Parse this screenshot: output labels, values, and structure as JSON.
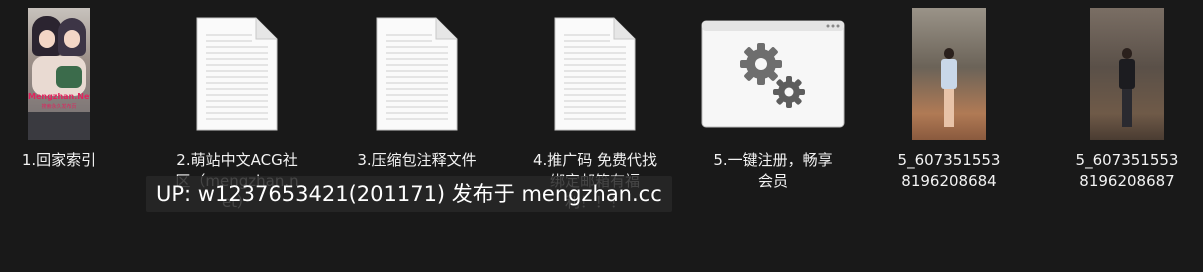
{
  "files": [
    {
      "label": "1.回家索引",
      "type": "image",
      "thumb_text": "Mengzhan.Net",
      "thumb_subtext": "搜索永久发布页"
    },
    {
      "label": "2.萌站中文ACG社区（mengzhan.net）",
      "type": "text-document",
      "icon": "text-document-icon"
    },
    {
      "label": "3.压缩包注释文件",
      "type": "text-document",
      "icon": "text-document-icon"
    },
    {
      "label": "4.推广码 免费代找 绑定邮箱有福利！！！",
      "type": "text-document",
      "icon": "text-document-icon"
    },
    {
      "label": "5.一键注册，畅享会员",
      "type": "application",
      "icon": "settings-gears-icon"
    },
    {
      "label": "5_6073515538196208684",
      "type": "image"
    },
    {
      "label": "5_6073515538196208687",
      "type": "image"
    }
  ],
  "watermark": "UP: w1237653421(201171) 发布于 mengzhan.cc",
  "colors": {
    "background": "#191919",
    "label_text": "#f2f2f2",
    "gear": "#6e6e6e"
  }
}
